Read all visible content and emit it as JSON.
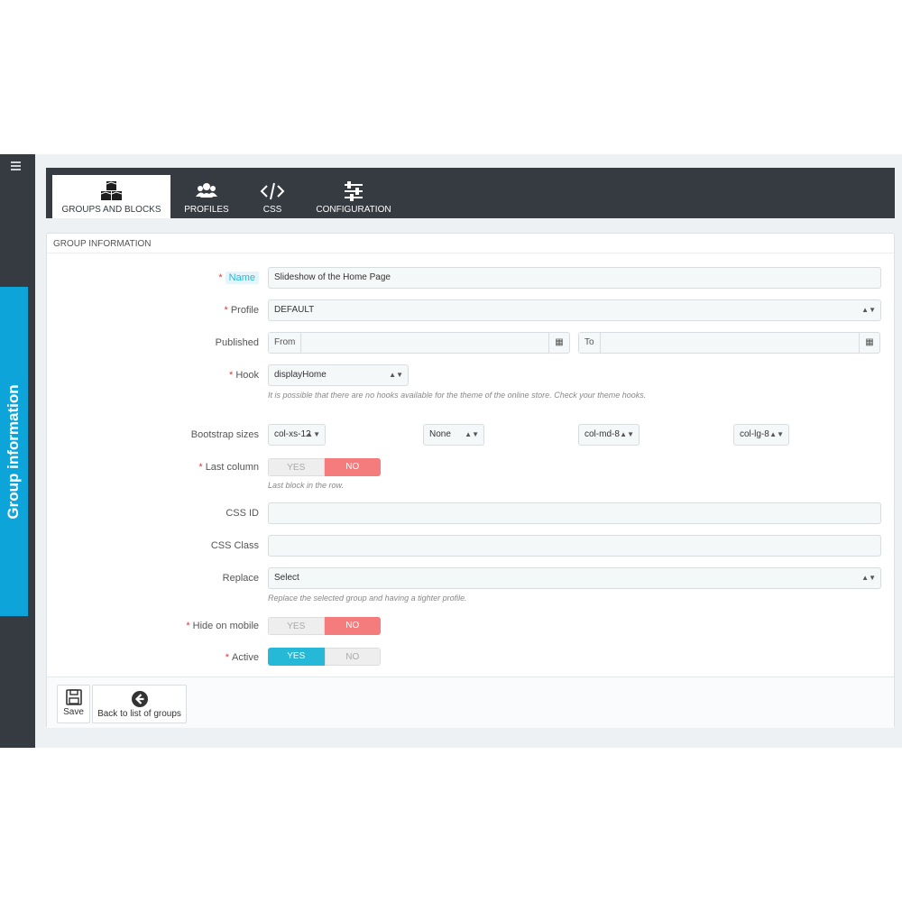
{
  "sidebar": {
    "menu_icon": "hamburger-icon",
    "vertical_tab_label": "Group information"
  },
  "tabs": [
    {
      "label": "GROUPS AND BLOCKS",
      "icon": "cubes-icon",
      "active": true
    },
    {
      "label": "PROFILES",
      "icon": "users-icon",
      "active": false
    },
    {
      "label": "CSS",
      "icon": "code-icon",
      "active": false
    },
    {
      "label": "CONFIGURATION",
      "icon": "sliders-icon",
      "active": false
    }
  ],
  "panel": {
    "title": "GROUP INFORMATION"
  },
  "form": {
    "name_label": "Name",
    "name_value": "Slideshow of the Home Page",
    "profile_label": "Profile",
    "profile_value": "DEFAULT",
    "published_label": "Published",
    "from_label": "From",
    "to_label": "To",
    "hook_label": "Hook",
    "hook_value": "displayHome",
    "hook_help": "It is possible that there are no hooks available for the theme of the online store. Check your theme hooks.",
    "bootstrap_label": "Bootstrap sizes",
    "bootstrap_xs": "col-xs-12",
    "bootstrap_sm": "None",
    "bootstrap_md": "col-md-8",
    "bootstrap_lg": "col-lg-8",
    "last_column_label": "Last column",
    "last_column_help": "Last block in the row.",
    "css_id_label": "CSS ID",
    "css_class_label": "CSS Class",
    "replace_label": "Replace",
    "replace_value": "Select",
    "replace_help": "Replace the selected group and having a tighter profile.",
    "hide_mobile_label": "Hide on mobile",
    "active_label": "Active",
    "yes_label": "YES",
    "no_label": "NO",
    "required_mark": "*"
  },
  "toggles": {
    "last_column": "NO",
    "hide_on_mobile": "NO",
    "active": "YES"
  },
  "footer": {
    "save_label": "Save",
    "back_label": "Back to list of groups"
  },
  "colors": {
    "accent": "#25b9d7",
    "danger": "#f57c7d",
    "dark": "#363a41",
    "side_tab": "#0ca4d9"
  }
}
